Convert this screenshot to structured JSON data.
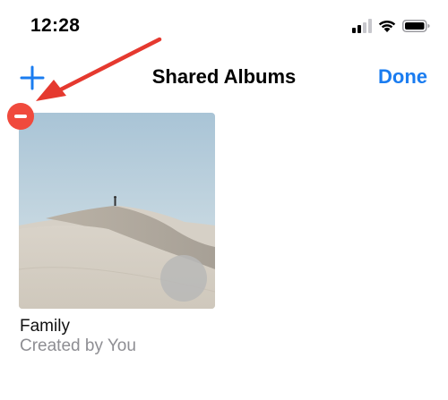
{
  "status_bar": {
    "time": "12:28",
    "icons": [
      "cellular-signal-icon",
      "wifi-icon",
      "battery-icon"
    ]
  },
  "nav_bar": {
    "add_icon": "plus-icon",
    "title": "Shared Albums",
    "done_label": "Done"
  },
  "albums": [
    {
      "title": "Family",
      "subtitle": "Created by You",
      "delete_icon": "minus-circle-icon"
    }
  ],
  "colors": {
    "accent": "#1a7cf0",
    "delete": "#f04a3d",
    "secondary_text": "#8e8e93",
    "annotation_arrow": "#e5392f"
  }
}
